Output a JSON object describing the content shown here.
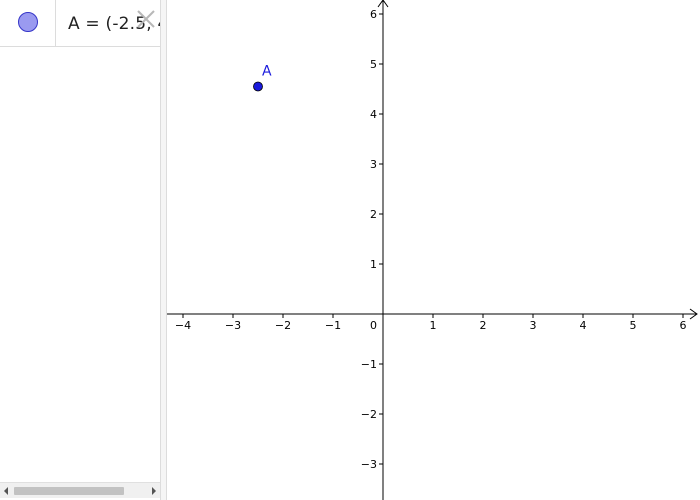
{
  "algebra": {
    "object_text": "A = (-2.5, 4",
    "point_color": "#9a9af0"
  },
  "graphics": {
    "x_ticks": [
      -4,
      -3,
      -2,
      -1,
      1,
      2,
      3,
      4,
      5,
      6
    ],
    "y_ticks": [
      -3,
      -2,
      -1,
      1,
      2,
      3,
      4,
      5,
      6
    ],
    "x_labels": [
      "−4",
      "−3",
      "−2",
      "−1",
      "1",
      "2",
      "3",
      "4",
      "5",
      "6"
    ],
    "y_labels": [
      "−3",
      "−2",
      "−1",
      "1",
      "2",
      "3",
      "4",
      "5",
      "6"
    ],
    "origin_label": "0",
    "point": {
      "name": "A",
      "x": -2.5,
      "y": 4.55,
      "color": "#1a1adc"
    }
  },
  "icons": [
    "visibility-toggle-icon",
    "close-icon",
    "scroll-left-icon",
    "scroll-right-icon"
  ]
}
